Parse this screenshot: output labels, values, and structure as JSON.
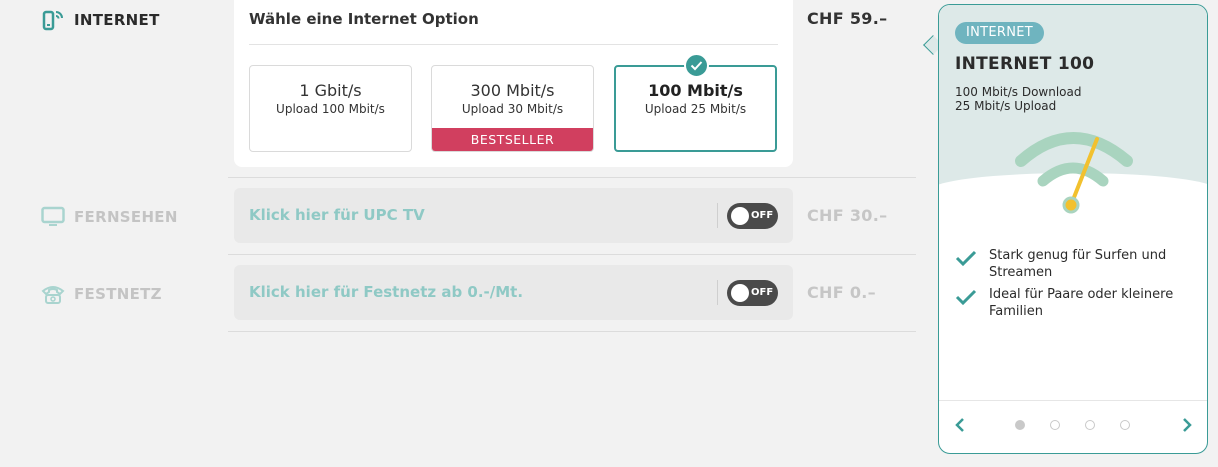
{
  "rows": {
    "internet": {
      "label": "INTERNET",
      "price": "CHF 59.–",
      "icon": "router-wifi-icon"
    },
    "tv": {
      "label": "FERNSEHEN",
      "price": "CHF 30.–",
      "icon": "tv-icon",
      "cta": "Klick hier für UPC TV",
      "toggle": "OFF"
    },
    "phone": {
      "label": "FESTNETZ",
      "price": "CHF 0.–",
      "icon": "telephone-icon",
      "cta": "Klick hier für Festnetz ab 0.-/Mt.",
      "toggle": "OFF"
    }
  },
  "internet_options": {
    "title": "Wähle eine Internet Option",
    "options": [
      {
        "speed": "1 Gbit/s",
        "upload": "Upload 100 Mbit/s",
        "badge": "",
        "selected": false
      },
      {
        "speed": "300 Mbit/s",
        "upload": "Upload 30 Mbit/s",
        "badge": "BESTSELLER",
        "selected": false
      },
      {
        "speed": "100 Mbit/s",
        "upload": "Upload 25 Mbit/s",
        "badge": "",
        "selected": true
      }
    ]
  },
  "panel": {
    "tag": "INTERNET",
    "title": "INTERNET 100",
    "download": "100 Mbit/s Download",
    "upload": "25 Mbit/s Upload",
    "features": [
      "Stark genug für Surfen und Streamen",
      "Ideal für Paare oder kleinere Familien"
    ],
    "pagination": {
      "total": 4,
      "current": 1
    }
  },
  "colors": {
    "accent": "#3a9b96",
    "badge": "#d13f5f",
    "gauge_needle": "#f2c12e",
    "wifi_waves": "#a9d4bf"
  }
}
